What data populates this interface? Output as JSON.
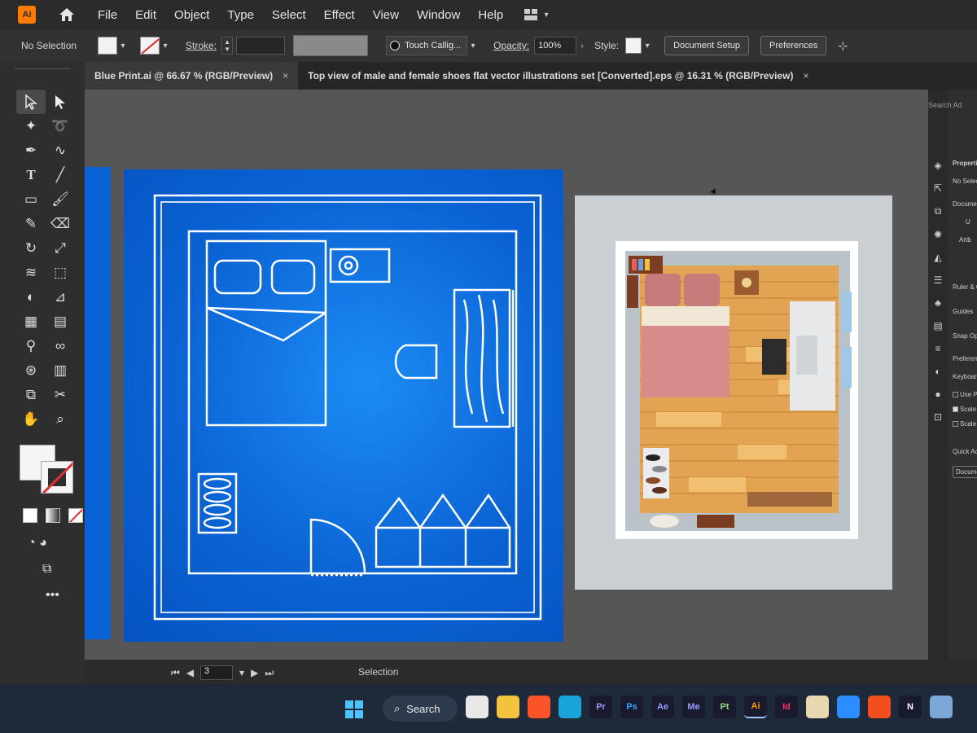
{
  "app": {
    "logo_text": "Ai"
  },
  "menu": [
    "File",
    "Edit",
    "Object",
    "Type",
    "Select",
    "Effect",
    "View",
    "Window",
    "Help"
  ],
  "controlbar": {
    "selection_status": "No Selection",
    "stroke_label": "Stroke:",
    "brush_name": "Touch Callig...",
    "opacity_label": "Opacity:",
    "opacity_value": "100%",
    "style_label": "Style:",
    "document_setup": "Document Setup",
    "preferences": "Preferences"
  },
  "tabs": [
    {
      "title": "Blue Print.ai @ 66.67 % (RGB/Preview)",
      "close": "×"
    },
    {
      "title": "Top view of male and female shoes flat vector illustrations set [Converted].eps @ 16.31 % (RGB/Preview)",
      "close": "×"
    }
  ],
  "right_panel": {
    "search_hint": "Search Ad",
    "items": [
      "Properti",
      "No Selectio",
      "Document",
      "U",
      "Artb",
      "Ruler & Gri",
      "Guides",
      "Snap Option",
      "Preferences",
      "Keyboard Inc",
      "Use Prev",
      "Scale Co",
      "Scale Str",
      "Quick Action",
      "Docume"
    ]
  },
  "statusbar": {
    "page_value": "3",
    "current_tool": "Selection"
  },
  "taskbar": {
    "search_label": "Search",
    "apps": [
      {
        "name": "file-manager",
        "label": "",
        "color": "#e8e8e8"
      },
      {
        "name": "explorer",
        "label": "",
        "color": "#f4c33d"
      },
      {
        "name": "brave",
        "label": "",
        "color": "#fb542b"
      },
      {
        "name": "edge",
        "label": "",
        "color": "#1aa4d8"
      },
      {
        "name": "premiere",
        "label": "Pr",
        "color": "#9999ff"
      },
      {
        "name": "photoshop",
        "label": "Ps",
        "color": "#31a8ff"
      },
      {
        "name": "after-effects",
        "label": "Ae",
        "color": "#9999ff"
      },
      {
        "name": "media-encoder",
        "label": "Me",
        "color": "#9999ff"
      },
      {
        "name": "prelude",
        "label": "Pt",
        "color": "#8fe07f"
      },
      {
        "name": "illustrator",
        "label": "Ai",
        "color": "#ff9a00"
      },
      {
        "name": "indesign",
        "label": "Id",
        "color": "#ff3366"
      },
      {
        "name": "app-1",
        "label": "",
        "color": "#e8d8b0"
      },
      {
        "name": "app-2",
        "label": "",
        "color": "#2d8cff"
      },
      {
        "name": "figma",
        "label": "",
        "color": "#f24e1e"
      },
      {
        "name": "notion",
        "label": "N",
        "color": "#ffffff"
      },
      {
        "name": "app-3",
        "label": "",
        "color": "#7aa7d8"
      }
    ]
  },
  "colors": {
    "blueprint": "#0b63d4",
    "illustrator_orange": "#ff7c00",
    "canvas_bg": "#565656"
  }
}
